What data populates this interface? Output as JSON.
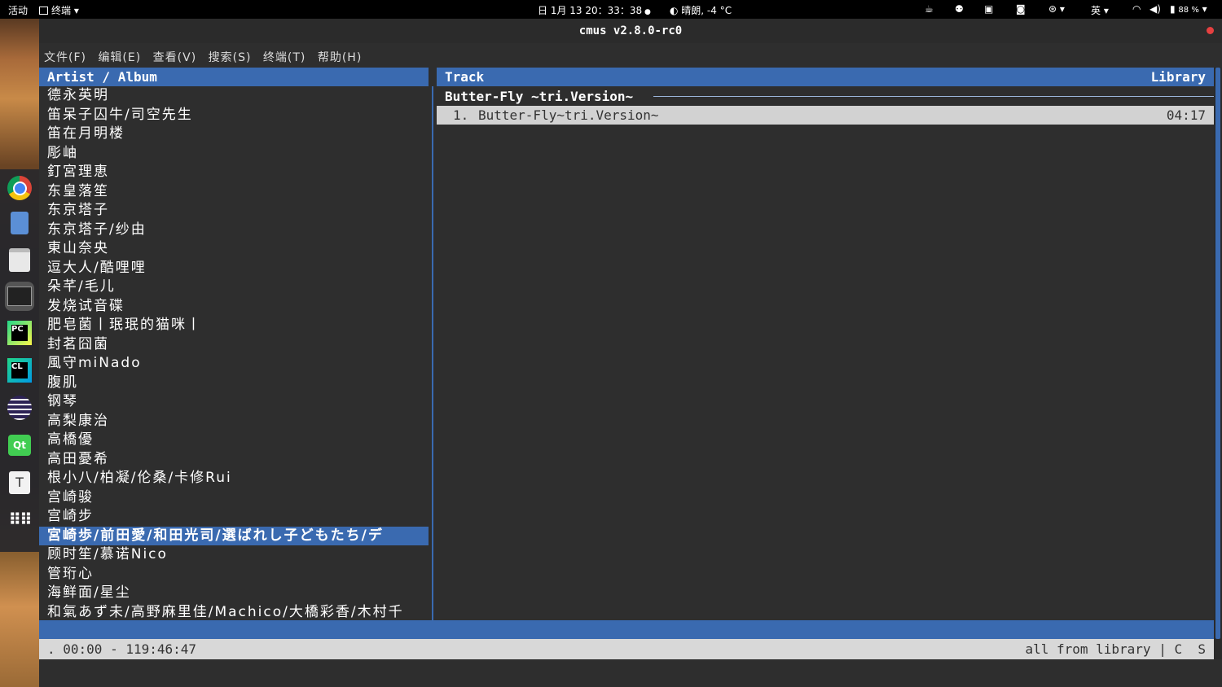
{
  "topbar": {
    "activities": "活动",
    "app_name": "终端",
    "clock": "日 1月 13  20：33：38",
    "weather": "晴朗, -4 °C",
    "input_method": "英",
    "battery": "88 %"
  },
  "window": {
    "title": "cmus v2.8.0-rc0"
  },
  "menu": [
    "文件(F)",
    "编辑(E)",
    "查看(V)",
    "搜索(S)",
    "终端(T)",
    "帮助(H)"
  ],
  "cmus": {
    "left_header": "Artist / Album",
    "right_header": "Track",
    "right_header_mode": "Library",
    "artists": [
      "德永英明",
      "笛呆子囚牛/司空先生",
      "笛在月明楼",
      "彫岫",
      "釘宮理恵",
      "东皇落笙",
      "东京塔子",
      "东京塔子/纱由",
      "東山奈央",
      "逗大人/酷哩哩",
      "朵芊/毛儿",
      "发烧试音碟",
      "肥皂菌丨珉珉的猫咪丨",
      "封茗囧菌",
      "風守miNado",
      "腹肌",
      "钢琴",
      "高梨康治",
      "高橋優",
      "高田憂希",
      "根小八/柏凝/伦桑/卡修Rui",
      "宫崎骏",
      "宫崎步",
      "宮崎歩/前田愛/和田光司/選ばれし子どもたち/デ",
      "顾时笙/慕诺Nico",
      "管珩心",
      "海鲜面/星尘",
      "和氣あず未/高野麻里佳/Machico/大橋彩香/木村千"
    ],
    "selected_index": 23,
    "album_title": "Butter-Fly ~tri.Version~",
    "tracks": [
      {
        "num": "1.",
        "title": "Butter-Fly~tri.Version~",
        "duration": "04:17"
      }
    ],
    "status_left": ". 00:00 - 119:46:47",
    "status_right": "all from library | C  S"
  }
}
